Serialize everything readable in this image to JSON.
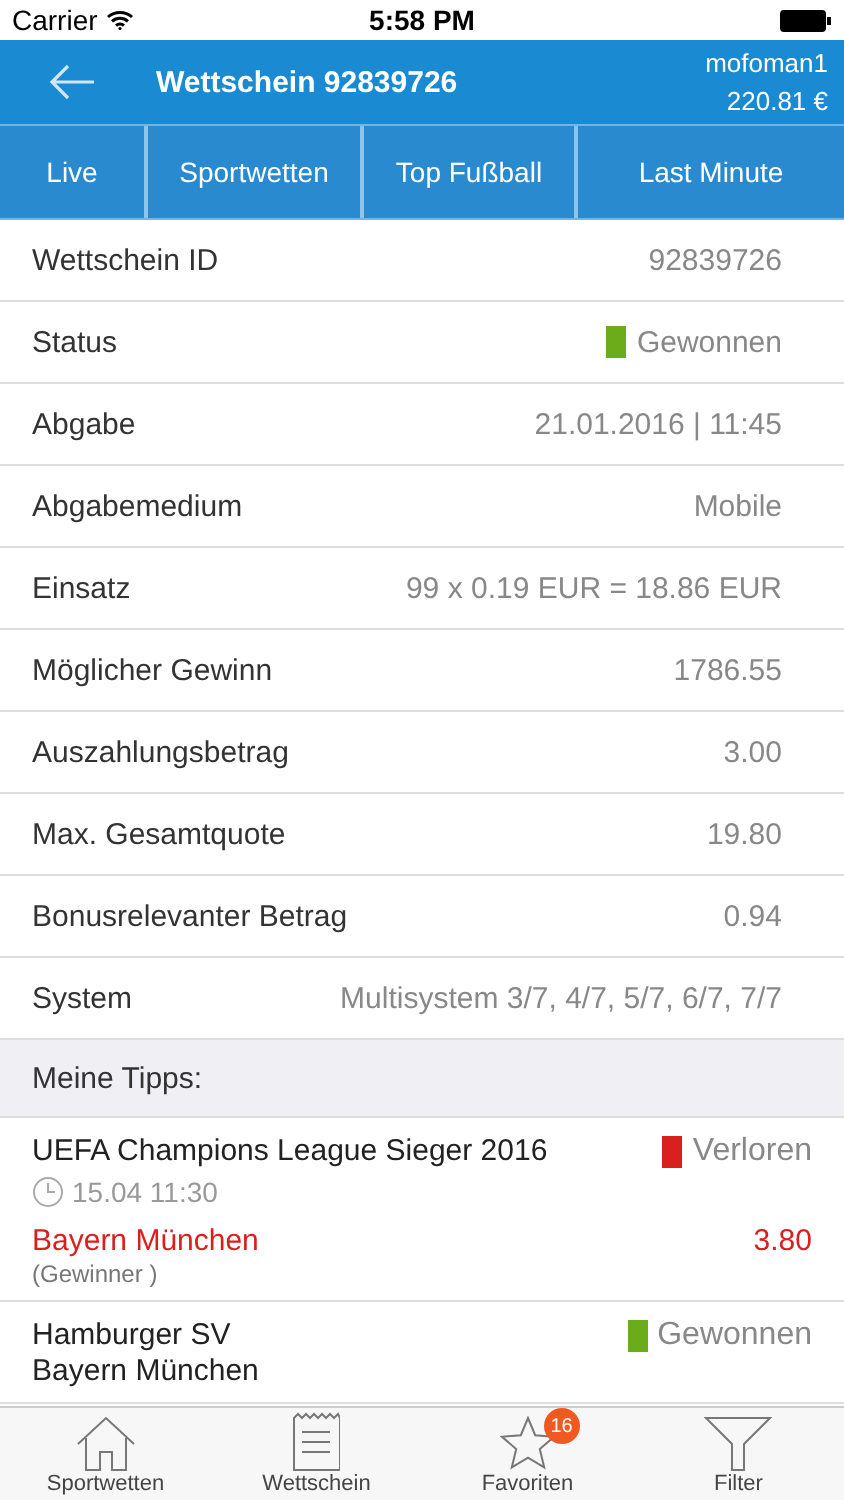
{
  "status_bar": {
    "carrier": "Carrier",
    "time": "5:58 PM"
  },
  "header": {
    "title": "Wettschein 92839726",
    "user": "mofoman1",
    "balance": "220.81 €"
  },
  "tabs": [
    {
      "label": "Live",
      "selected": false
    },
    {
      "label": "Sportwetten",
      "selected": false
    },
    {
      "label": "Top Fußball",
      "selected": false
    },
    {
      "label": "Last Minute",
      "selected": false
    }
  ],
  "details": [
    {
      "label": "Wettschein ID",
      "value": "92839726"
    },
    {
      "label": "Status",
      "value": "Gewonnen",
      "kind": "won"
    },
    {
      "label": "Abgabe",
      "value": "21.01.2016 | 11:45"
    },
    {
      "label": "Abgabemedium",
      "value": "Mobile"
    },
    {
      "label": "Einsatz",
      "value": "99 x 0.19 EUR = 18.86 EUR"
    },
    {
      "label": "Möglicher Gewinn",
      "value": "1786.55"
    },
    {
      "label": "Auszahlungsbetrag",
      "value": "3.00"
    },
    {
      "label": "Max. Gesamtquote",
      "value": "19.80"
    },
    {
      "label": "Bonusrelevanter Betrag",
      "value": "0.94"
    },
    {
      "label": "System",
      "value": "Multisystem 3/7, 4/7, 5/7, 6/7, 7/7"
    }
  ],
  "tips_header": "Meine Tipps:",
  "tips": [
    {
      "event": "UEFA Champions League Sieger 2016",
      "kind": "lost",
      "status": "Verloren",
      "time": "15.04 11:30",
      "pick": "Bayern München",
      "pick_note": "(Gewinner )",
      "odds": "3.80"
    },
    {
      "event": "Hamburger SV",
      "event_line2": "Bayern München",
      "kind": "won",
      "status": "Gewonnen"
    }
  ],
  "tab_bar": [
    {
      "label": "Sportwetten",
      "kind": "home"
    },
    {
      "label": "Wettschein",
      "kind": "slip"
    },
    {
      "label": "Favoriten",
      "kind": "favorites",
      "badge": "16"
    },
    {
      "label": "Filter",
      "kind": "filter"
    }
  ]
}
